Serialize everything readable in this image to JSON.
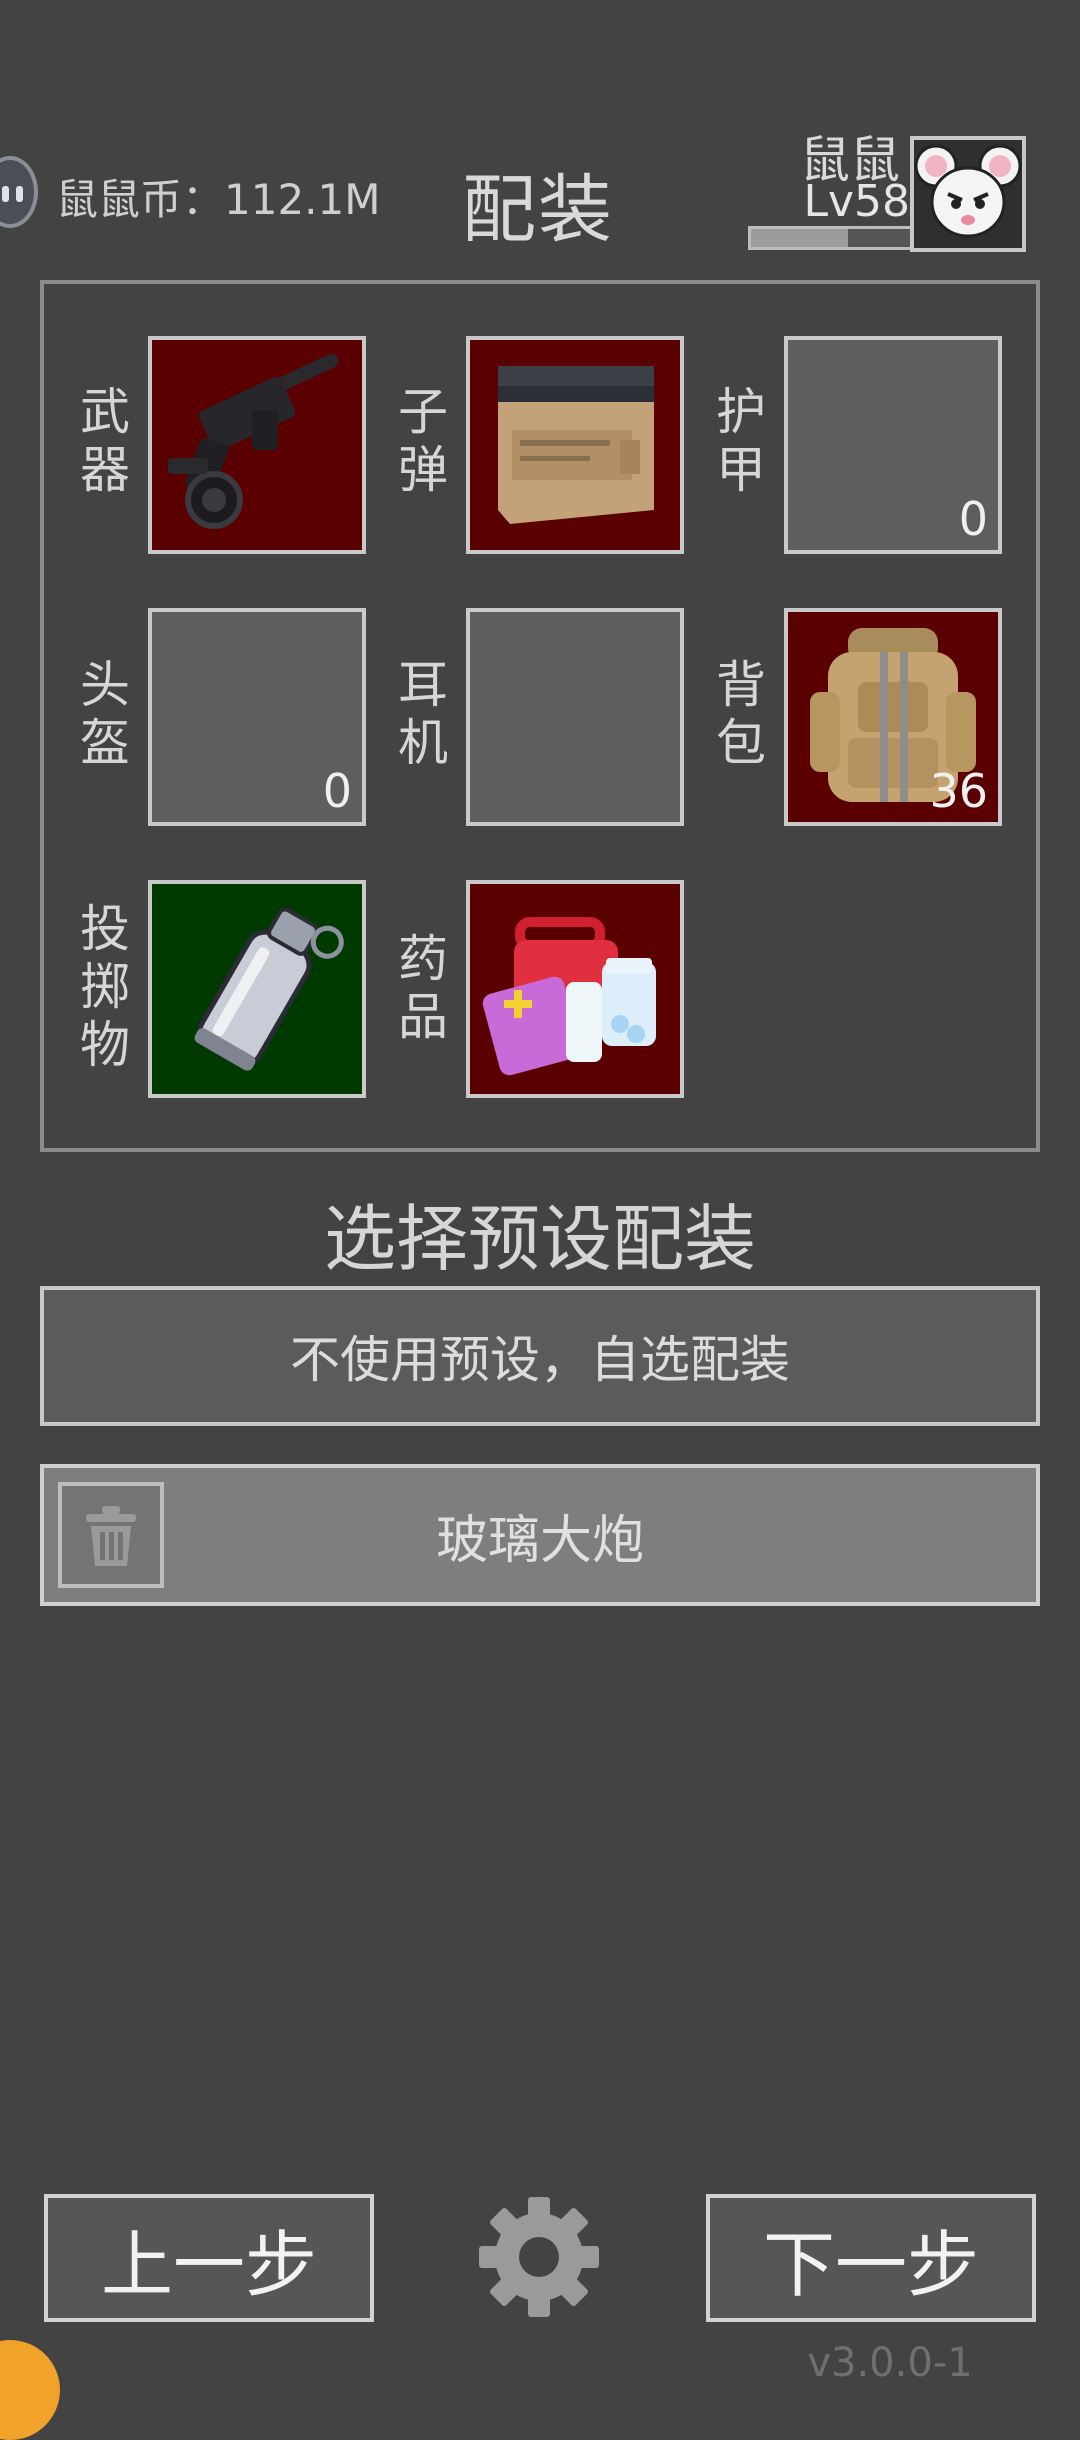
{
  "header": {
    "coin_label": "鼠鼠币：112.1M",
    "title": "配装",
    "user_name": "鼠鼠",
    "user_level": "Lv58",
    "xp_fraction": 0.6
  },
  "slots": {
    "weapon": {
      "label": "武\n器",
      "item": "rifle-icon"
    },
    "ammo": {
      "label": "子\n弹",
      "item": "ammo-box-icon"
    },
    "armor": {
      "label": "护\n甲",
      "count": "0"
    },
    "helmet": {
      "label": "头\n盔",
      "count": "0"
    },
    "headset": {
      "label": "耳\n机"
    },
    "backpack": {
      "label": "背\n包",
      "count": "36",
      "item": "backpack-icon"
    },
    "throwable": {
      "label": "投\n掷\n物",
      "item": "grenade-icon"
    },
    "medicine": {
      "label": "药\n品",
      "item": "medkit-icon"
    }
  },
  "presets": {
    "title": "选择预设配装",
    "no_preset_label": "不使用预设，自选配装",
    "items": [
      {
        "name": "玻璃大炮"
      }
    ]
  },
  "footer": {
    "prev_label": "上一步",
    "next_label": "下一步",
    "version": "v3.0.0-1"
  },
  "colors": {
    "background": "#434343",
    "slot_red": "#5a0000",
    "slot_green": "#003a00",
    "slot_empty": "#5e5e5e",
    "accent_corner": "#f0a22a"
  }
}
